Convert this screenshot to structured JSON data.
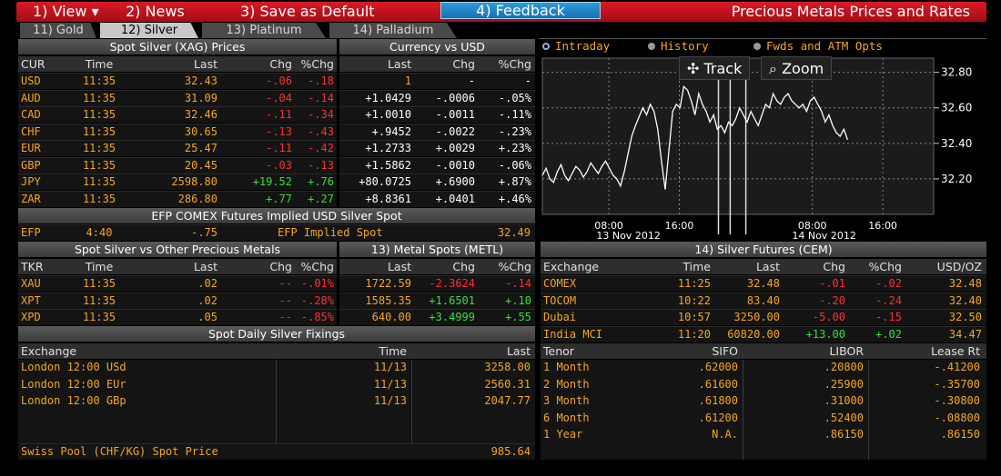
{
  "menu": {
    "view": "1) View ▾",
    "news": "2) News",
    "save": "3) Save as Default",
    "feedback": "4) Feedback",
    "title": "Precious Metals Prices and Rates"
  },
  "tabs": [
    "11) Gold",
    "12) Silver",
    "13) Platinum",
    "14) Palladium"
  ],
  "spot_silver": {
    "title": "Spot Silver (XAG) Prices",
    "headers": [
      "CUR",
      "Time",
      "Last",
      "Chg",
      "%Chg"
    ],
    "rows": [
      {
        "cur": "USD",
        "time": "11:35",
        "last": "32.43",
        "chg": "-.06",
        "pct": "-.18"
      },
      {
        "cur": "AUD",
        "time": "11:35",
        "last": "31.09",
        "chg": "-.04",
        "pct": "-.14"
      },
      {
        "cur": "CAD",
        "time": "11:35",
        "last": "32.46",
        "chg": "-.11",
        "pct": "-.34"
      },
      {
        "cur": "CHF",
        "time": "11:35",
        "last": "30.65",
        "chg": "-.13",
        "pct": "-.43"
      },
      {
        "cur": "EUR",
        "time": "11:35",
        "last": "25.47",
        "chg": "-.11",
        "pct": "-.42"
      },
      {
        "cur": "GBP",
        "time": "11:35",
        "last": "20.45",
        "chg": "-.03",
        "pct": "-.13"
      },
      {
        "cur": "JPY",
        "time": "11:35",
        "last": "2598.80",
        "chg": "+19.52",
        "pct": "+.76"
      },
      {
        "cur": "ZAR",
        "time": "11:35",
        "last": "286.80",
        "chg": "+.77",
        "pct": "+.27"
      }
    ]
  },
  "currency_usd": {
    "title": "Currency vs USD",
    "headers": [
      "Last",
      "Chg",
      "%Chg"
    ],
    "rows": [
      {
        "last": "1",
        "chg": "-",
        "pct": "-"
      },
      {
        "last": "+1.0429",
        "chg": "-.0006",
        "pct": "-.05%"
      },
      {
        "last": "+1.0010",
        "chg": "-.0011",
        "pct": "-.11%"
      },
      {
        "last": "+.9452",
        "chg": "-.0022",
        "pct": "-.23%"
      },
      {
        "last": "+1.2733",
        "chg": "+.0029",
        "pct": "+.23%"
      },
      {
        "last": "+1.5862",
        "chg": "-.0010",
        "pct": "-.06%"
      },
      {
        "last": "+80.0725",
        "chg": "+.6900",
        "pct": "+.87%"
      },
      {
        "last": "+8.8361",
        "chg": "+.0401",
        "pct": "+.46%"
      }
    ]
  },
  "efp": {
    "title": "EFP COMEX Futures Implied USD Silver Spot",
    "label": "EFP",
    "time": "4:40",
    "value": "-.75",
    "implied_label": "EFP Implied Spot",
    "implied_value": "32.49"
  },
  "other_metals": {
    "title": "Spot Silver vs Other Precious Metals",
    "headers": [
      "TKR",
      "Time",
      "Last",
      "Chg",
      "%Chg"
    ],
    "rows": [
      {
        "tkr": "XAU",
        "time": "11:35",
        "last": ".02",
        "chg": "--",
        "pct": "-.01%"
      },
      {
        "tkr": "XPT",
        "time": "11:35",
        "last": ".02",
        "chg": "--",
        "pct": "-.28%"
      },
      {
        "tkr": "XPD",
        "time": "11:35",
        "last": ".05",
        "chg": "--",
        "pct": "-.85%"
      }
    ]
  },
  "metal_spots": {
    "title": "13) Metal Spots (METL)",
    "headers": [
      "Last",
      "Chg",
      "%Chg"
    ],
    "rows": [
      {
        "last": "1722.59",
        "chg": "-2.3624",
        "pct": "-.14"
      },
      {
        "last": "1585.35",
        "chg": "+1.6501",
        "pct": "+.10"
      },
      {
        "last": "640.00",
        "chg": "+3.4999",
        "pct": "+.55"
      }
    ]
  },
  "fixings": {
    "title": "Spot Daily Silver Fixings",
    "headers": [
      "Exchange",
      "Time",
      "Last"
    ],
    "rows": [
      {
        "exchange": "London 12:00 USd",
        "time": "11/13",
        "last": "3258.00"
      },
      {
        "exchange": "London 12:00 EUr",
        "time": "11/13",
        "last": "2560.31"
      },
      {
        "exchange": "London 12:00 GBp",
        "time": "11/13",
        "last": "2047.77"
      }
    ],
    "swiss_label": "Swiss Pool (CHF/KG) Spot Price",
    "swiss_value": "985.64"
  },
  "chart_options": {
    "intraday": "Intraday",
    "history": "History",
    "fwds": "Fwds and ATM Opts",
    "track": "Track",
    "zoom": "Zoom"
  },
  "chart_data": {
    "type": "line",
    "yticks": [
      "32.80",
      "32.60",
      "32.40",
      "32.20"
    ],
    "ylim": [
      32.0,
      32.88
    ],
    "xticks": [
      "08:00",
      "16:00",
      "08:00",
      "16:00"
    ],
    "dates": [
      "13 Nov 2012",
      "14 Nov 2012"
    ],
    "values": [
      32.22,
      32.26,
      32.2,
      32.18,
      32.24,
      32.28,
      32.22,
      32.19,
      32.23,
      32.27,
      32.25,
      32.21,
      32.24,
      32.29,
      32.26,
      32.23,
      32.27,
      32.3,
      32.26,
      32.22,
      32.2,
      32.16,
      32.24,
      32.34,
      32.44,
      32.5,
      32.55,
      32.6,
      32.56,
      32.62,
      32.58,
      32.48,
      32.3,
      32.14,
      32.36,
      32.58,
      32.62,
      32.6,
      32.72,
      32.7,
      32.64,
      32.56,
      32.68,
      32.62,
      32.58,
      32.52,
      32.56,
      32.48,
      32.5,
      32.46,
      32.52,
      32.5,
      32.54,
      32.6,
      32.56,
      32.52,
      32.58,
      32.54,
      32.5,
      32.56,
      32.62,
      32.6,
      32.68,
      32.64,
      32.62,
      32.66,
      32.68,
      32.64,
      32.62,
      32.6,
      32.62,
      32.58,
      32.64,
      32.66,
      32.62,
      32.58,
      32.52,
      32.56,
      32.5,
      32.46,
      32.44,
      32.48,
      32.42
    ]
  },
  "silver_futures": {
    "title": "14) Silver Futures (CEM)",
    "headers": [
      "Exchange",
      "Time",
      "Last",
      "Chg",
      "%Chg",
      "USD/OZ"
    ],
    "rows": [
      {
        "exchange": "COMEX",
        "time": "11:25",
        "last": "32.48",
        "chg": "-.01",
        "pct": "-.02",
        "usd": "32.48"
      },
      {
        "exchange": "TOCOM",
        "time": "10:22",
        "last": "83.40",
        "chg": "-.20",
        "pct": "-.24",
        "usd": "32.40"
      },
      {
        "exchange": "Dubai",
        "time": "10:57",
        "last": "3250.00",
        "chg": "-5.00",
        "pct": "-.15",
        "usd": "32.50"
      },
      {
        "exchange": "India MCI",
        "time": "11:20",
        "last": "60820.00",
        "chg": "+13.00",
        "pct": "+.02",
        "usd": "34.47"
      }
    ]
  },
  "rates": {
    "headers": [
      "Tenor",
      "SIFO",
      "LIBOR",
      "Lease Rt"
    ],
    "rows": [
      {
        "tenor": "1 Month",
        "sifo": ".62000",
        "libor": ".20800",
        "lease": "-.41200"
      },
      {
        "tenor": "2 Month",
        "sifo": ".61600",
        "libor": ".25900",
        "lease": "-.35700"
      },
      {
        "tenor": "3 Month",
        "sifo": ".61800",
        "libor": ".31000",
        "lease": "-.30800"
      },
      {
        "tenor": "6 Month",
        "sifo": ".61200",
        "libor": ".52400",
        "lease": "-.08800"
      },
      {
        "tenor": "1 Year",
        "sifo": "N.A.",
        "libor": ".86150",
        "lease": ".86150"
      }
    ]
  }
}
